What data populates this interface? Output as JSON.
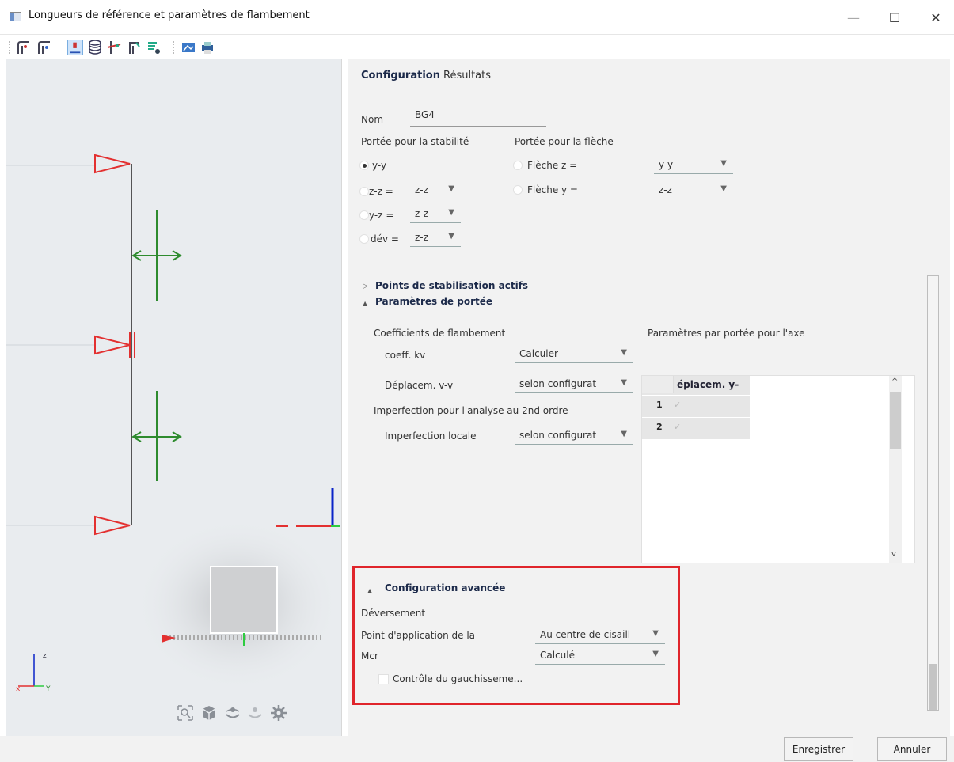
{
  "window": {
    "title": "Longueurs de référence et paramètres de flambement",
    "minimize": "—",
    "maximize": "☐",
    "close": "✕"
  },
  "toolbar": {
    "icons": [
      "buckling-length-icon-1",
      "buckling-length-icon-2",
      "node-support-icon",
      "database-icon",
      "member-split-icon",
      "beam-config-icon",
      "list-filter-icon",
      "image-export-icon",
      "print-icon"
    ]
  },
  "tabs": [
    {
      "label": "Configuration",
      "active": true
    },
    {
      "label": "Résultats",
      "active": false
    }
  ],
  "nom": {
    "label": "Nom",
    "value": "BG4"
  },
  "stabilite": {
    "heading": "Portée pour la stabilité",
    "options": [
      {
        "label": "y-y",
        "selected": true,
        "value": ""
      },
      {
        "label": "z-z =",
        "selected": false,
        "value": "z-z"
      },
      {
        "label": "y-z =",
        "selected": false,
        "value": "z-z"
      },
      {
        "label": "dév =",
        "selected": false,
        "value": "z-z"
      }
    ]
  },
  "fleche": {
    "heading": "Portée pour la flèche",
    "options": [
      {
        "label": "Flèche z =",
        "value": "y-y"
      },
      {
        "label": "Flèche y =",
        "value": "z-z"
      }
    ]
  },
  "sections": {
    "points": "Points de stabilisation actifs",
    "portee": "Paramètres de portée"
  },
  "coefficients": {
    "heading": "Coefficients de flambement",
    "kv_label": "coeff. kv",
    "kv_value": "Calculer",
    "dep_label": "Déplacem. v-v",
    "dep_value": "selon configurat",
    "imperf_heading": "Imperfection pour l'analyse au 2nd ordre",
    "imperf_label": "Imperfection locale",
    "imperf_value": "selon configurat"
  },
  "table": {
    "heading": "Paramètres par portée pour l'axe",
    "column": "éplacem. y-",
    "rows": [
      "1",
      "2"
    ]
  },
  "advanced": {
    "heading": "Configuration avancée",
    "deversement": "Déversement",
    "point_label": "Point d'application de la",
    "point_value": "Au centre de cisaill",
    "mcr_label": "Mcr",
    "mcr_value": "Calculé",
    "gauchissement": "Contrôle du gauchisseme..."
  },
  "buttons": {
    "save": "Enregistrer",
    "cancel": "Annuler"
  },
  "axes": {
    "x": "x",
    "y": "Y",
    "z": "z"
  },
  "colors": {
    "accent_red": "#e0252b",
    "support_red": "#e33030",
    "restraint_green": "#2e8b2e",
    "axis_blue": "#0a24c8"
  }
}
